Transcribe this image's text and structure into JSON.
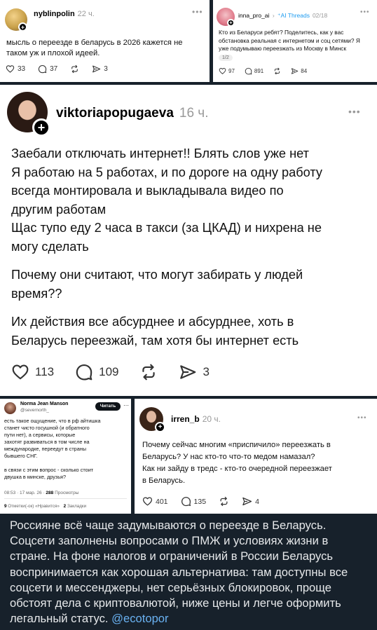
{
  "post1": {
    "username": "nyblinpolin",
    "time": "22 ч.",
    "text_lines": [
      "мысль о переезде в беларусь в 2026 кажется не",
      "таком уж и плохой идеей."
    ],
    "likes": "33",
    "comments": "37",
    "shares": "3"
  },
  "post2": {
    "username": "inna_pro_ai",
    "topic": "AI Threads",
    "time": "02/18",
    "text_lines": [
      "Кто из Беларуси ребят? Поделитесь, как у вас",
      "обстановка реальная с интернетом и соц сетями? Я",
      "уже подумываю переезжать из Москву в Минск"
    ],
    "pager": "1/2",
    "likes": "97",
    "comments": "891",
    "shares": "84"
  },
  "post3": {
    "username": "viktoriapopugaeva",
    "time": "16 ч.",
    "paragraph1": [
      "Заебали отключать интернет!! Блять слов уже нет",
      "Я работаю на 5 работах, и по дороге на одну работу",
      "всегда монтировала и выкладывала видео по",
      "другим работам",
      "Щас тупо еду 2 часа в такси (за ЦКАД) и нихрена не",
      "могу сделать"
    ],
    "paragraph2": [
      "Почему они считают, что могут забирать у людей",
      "время??"
    ],
    "paragraph3": [
      "Их действия все абсурднее и абсурднее, хоть в",
      "Беларусь переезжай, там хотя бы интернет есть"
    ],
    "likes": "113",
    "comments": "109",
    "shares": "3"
  },
  "post4": {
    "name": "Norma Jean Manson",
    "handle": "@severnorth_",
    "read_button": "Читать",
    "text1": [
      "есть такое ощущение, что в рф айтишка",
      "станет чисто госушной (и обратного",
      "пути нет), а сервисы, которые",
      "захотят развиваться в том числе на",
      "международке, переедут в страны",
      "бывшего СНГ."
    ],
    "text2": [
      "в связи с этим вопрос - сколько стоит",
      "двушка в минске, друзья?"
    ],
    "meta_time": "08:53 · 17 мар. 26 ·",
    "views_count": "288",
    "views_label": "Просмотры",
    "quotes_count": "9",
    "quotes_label": "Отметки(-ок) «Нравится»",
    "bookmarks_count": "2",
    "bookmarks_label": "Закладки"
  },
  "post5": {
    "username": "irren_b",
    "time": "20 ч.",
    "text_lines": [
      "Почему сейчас многим «приспичило» переезжать в",
      "Беларусь? У нас кто-то что-то медом намазал?",
      "Как ни зайду в тредс - кто-то очередной переезжает",
      "в Беларусь."
    ],
    "likes": "401",
    "comments": "135",
    "shares": "4"
  },
  "channel_message": {
    "text": "Россияне всё чаще задумываются о переезде в Беларусь. Соцсети заполнены вопросами о ПМЖ и условиях жизни в стране. На фоне налогов и ограничений в России Беларусь воспринимается как хорошая альтернатива: там доступны все соцсети и мессенджеры, нет серьёзных блокировок, проще обстоят дела с криптовалютой, ниже цены и легче оформить легальный статус.",
    "mention": "@ecotopor"
  },
  "colors": {
    "background": "#17212b",
    "link": "#6ab2f2",
    "threads_blue": "#1d9bf0"
  }
}
